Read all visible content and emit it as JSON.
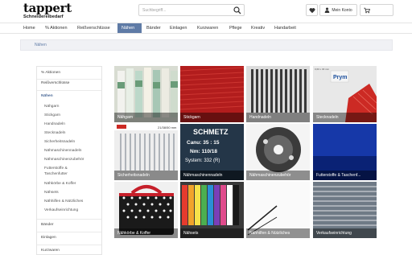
{
  "header": {
    "logo_main": "tappert",
    "logo_sub": "Schneidereibedarf",
    "search_placeholder": "Suchbegriff...",
    "account_label": "Mein Konto"
  },
  "nav": {
    "items": [
      "Home",
      "% Aktionen",
      "Reißverschlüsse",
      "Nähen",
      "Bänder",
      "Einlagen",
      "Kurzwaren",
      "Pflege",
      "Kreativ",
      "Handarbeit"
    ],
    "active_index": 3
  },
  "breadcrumb": {
    "current": "Nähen"
  },
  "sidebar": {
    "items": [
      {
        "label": "% Aktionen",
        "type": "top"
      },
      {
        "label": "Reißverschlüsse",
        "type": "top"
      },
      {
        "label": "Nähen",
        "type": "active"
      },
      {
        "label": "Nähgarn",
        "type": "sub"
      },
      {
        "label": "Stickgarn",
        "type": "sub"
      },
      {
        "label": "Handnadeln",
        "type": "sub"
      },
      {
        "label": "Stecknadeln",
        "type": "sub"
      },
      {
        "label": "Sicherheitsnadeln",
        "type": "sub"
      },
      {
        "label": "Nähmaschinennadeln",
        "type": "sub"
      },
      {
        "label": "Nähmaschinenzubehör",
        "type": "sub"
      },
      {
        "label": "Futterstoffe &",
        "type": "sub"
      },
      {
        "label": "Taschenfutter",
        "type": "sub"
      },
      {
        "label": "Nähkörbe & Koffer",
        "type": "sub"
      },
      {
        "label": "Nähsets",
        "type": "sub"
      },
      {
        "label": "Nähhilfen & Nützliches",
        "type": "sub"
      },
      {
        "label": "Verkaufseinrichtung",
        "type": "sub"
      },
      {
        "label": "Bänder",
        "type": "top"
      },
      {
        "label": "Einlagen",
        "type": "top"
      },
      {
        "label": "Kurzwaren",
        "type": "top"
      }
    ]
  },
  "tiles": [
    {
      "label": "Nähgarn"
    },
    {
      "label": "Stickgarn"
    },
    {
      "label": "Handnadeln"
    },
    {
      "label": "Stecknadeln"
    },
    {
      "label": "Sicherheitsnadeln"
    },
    {
      "label": "Nähmaschinennadeln"
    },
    {
      "label": "Nähmaschinenzubehör"
    },
    {
      "label": "Futterstoffe & Taschenf..."
    },
    {
      "label": "Nähkörbe & Koffer"
    },
    {
      "label": "Nähsets"
    },
    {
      "label": "Nähhilfen & Nützliches"
    },
    {
      "label": "Verkaufseinrichtung"
    }
  ],
  "packaging_text": {
    "schmetz_brand": "SCHMETZ",
    "schmetz_canu": "Canu:  35 : 15",
    "schmetz_nm": "Nm: 110/18",
    "schmetz_system": "System: 332 (R)",
    "pins_brand": "Prym",
    "pins_size": "0,60 x 30 mm",
    "safety_size": "21/38/50 mm"
  },
  "colors": {
    "accent": "#5f7ba6",
    "breadcrumb_bg": "#f0f1f5",
    "tile_overlay": "rgba(0,0,0,0.42)"
  }
}
